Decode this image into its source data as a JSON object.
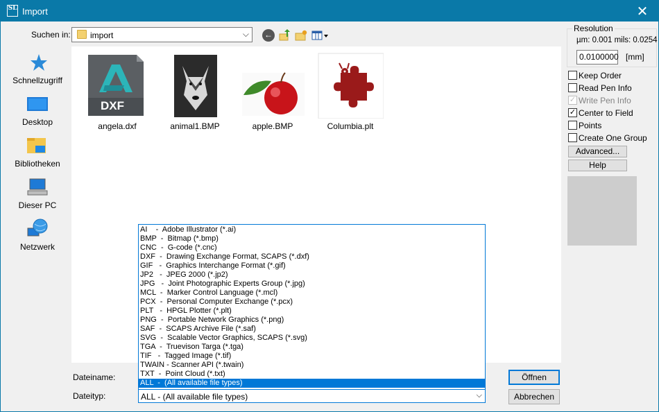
{
  "window": {
    "title": "Import",
    "app_icon": "SL",
    "close_glyph": "✕"
  },
  "lookin": {
    "label": "Suchen in:",
    "value": "import"
  },
  "places": [
    {
      "label": "Schnellzugriff",
      "icon": "star-icon"
    },
    {
      "label": "Desktop",
      "icon": "desktop-icon"
    },
    {
      "label": "Bibliotheken",
      "icon": "library-icon"
    },
    {
      "label": "Dieser PC",
      "icon": "computer-icon"
    },
    {
      "label": "Netzwerk",
      "icon": "network-icon"
    }
  ],
  "files": [
    {
      "name": "angela.dxf",
      "badge": "DXF"
    },
    {
      "name": "animal1.BMP"
    },
    {
      "name": "apple.BMP"
    },
    {
      "name": "Columbia.plt"
    }
  ],
  "filename": {
    "label": "Dateiname:",
    "value": ""
  },
  "filetype": {
    "label": "Dateityp:",
    "value": "ALL  -  (All available file types)",
    "options": [
      "AI    -  Adobe Illustrator (*.ai)",
      "BMP  -  Bitmap (*.bmp)",
      "CNC  -  G-code (*.cnc)",
      "DXF  -  Drawing Exchange Format, SCAPS (*.dxf)",
      "GIF   -  Graphics Interchange Format (*.gif)",
      "JP2   -  JPEG 2000 (*.jp2)",
      "JPG   -  Joint Photographic Experts Group (*.jpg)",
      "MCL  -  Marker Control Language (*.mcl)",
      "PCX  -  Personal Computer Exchange (*.pcx)",
      "PLT   -  HPGL Plotter (*.plt)",
      "PNG  -  Portable Network Graphics (*.png)",
      "SAF  -  SCAPS Archive File (*.saf)",
      "SVG  -  Scalable Vector Graphics, SCAPS (*.svg)",
      "TGA  -  Truevison Targa (*.tga)",
      "TIF   -  Tagged Image (*.tif)",
      "TWAIN - Scanner API (*.twain)",
      "TXT  -  Point Cloud (*.txt)",
      "ALL  -  (All available file types)"
    ]
  },
  "buttons": {
    "open": "Öffnen",
    "cancel": "Abbrechen",
    "advanced": "Advanced...",
    "help": "Help"
  },
  "resolution": {
    "title": "Resolution",
    "info": "µm: 0.001 mils: 0.0254",
    "value": "0.0100000",
    "unit": "[mm]"
  },
  "options": [
    {
      "label": "Keep Order",
      "checked": false,
      "disabled": false
    },
    {
      "label": "Read Pen Info",
      "checked": false,
      "disabled": false
    },
    {
      "label": "Write Pen Info",
      "checked": true,
      "disabled": true
    },
    {
      "label": "Center to Field",
      "checked": true,
      "disabled": false
    },
    {
      "label": "Points",
      "checked": false,
      "disabled": false
    },
    {
      "label": "Create One Group",
      "checked": false,
      "disabled": false
    }
  ],
  "colors": {
    "titlebar": "#0a79a8",
    "selection": "#0078d7",
    "dialog_bg": "#f0f0f0"
  }
}
